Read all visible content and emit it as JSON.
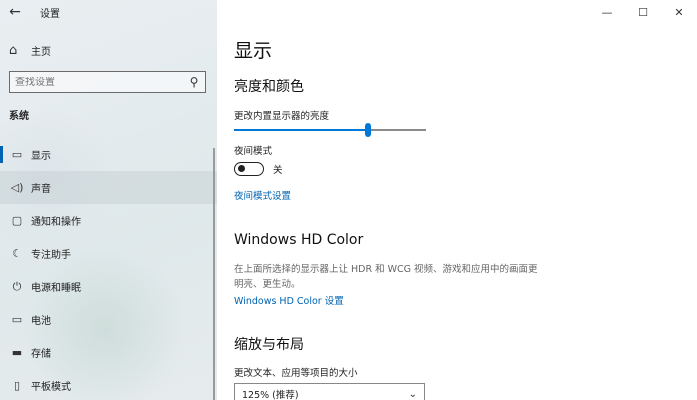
{
  "app": {
    "title": "设置"
  },
  "window_controls": {
    "minimize": "—",
    "maximize": "☐",
    "close": "✕"
  },
  "sidebar": {
    "home_label": "主页",
    "search_placeholder": "查找设置",
    "section": "系统",
    "items": [
      {
        "label": "显示",
        "icon": "monitor-icon",
        "active": true
      },
      {
        "label": "声音",
        "icon": "speaker-icon",
        "hover": true
      },
      {
        "label": "通知和操作",
        "icon": "notification-icon"
      },
      {
        "label": "专注助手",
        "icon": "moon-icon"
      },
      {
        "label": "电源和睡眠",
        "icon": "power-icon"
      },
      {
        "label": "电池",
        "icon": "battery-icon"
      },
      {
        "label": "存储",
        "icon": "storage-icon"
      },
      {
        "label": "平板模式",
        "icon": "tablet-icon"
      }
    ]
  },
  "main": {
    "page_title": "显示",
    "brightness": {
      "heading": "亮度和颜色",
      "slider_label": "更改内置显示器的亮度",
      "slider_value": 0.7
    },
    "night_light": {
      "label": "夜间模式",
      "state": "关",
      "settings_link": "夜间模式设置"
    },
    "hd_color": {
      "heading": "Windows HD Color",
      "description": "在上面所选择的显示器上让 HDR 和 WCG 视频、游戏和应用中的画面更明亮、更生动。",
      "link": "Windows HD Color 设置"
    },
    "scale": {
      "heading": "缩放与布局",
      "label": "更改文本、应用等项目的大小",
      "value": "125% (推荐)"
    }
  }
}
